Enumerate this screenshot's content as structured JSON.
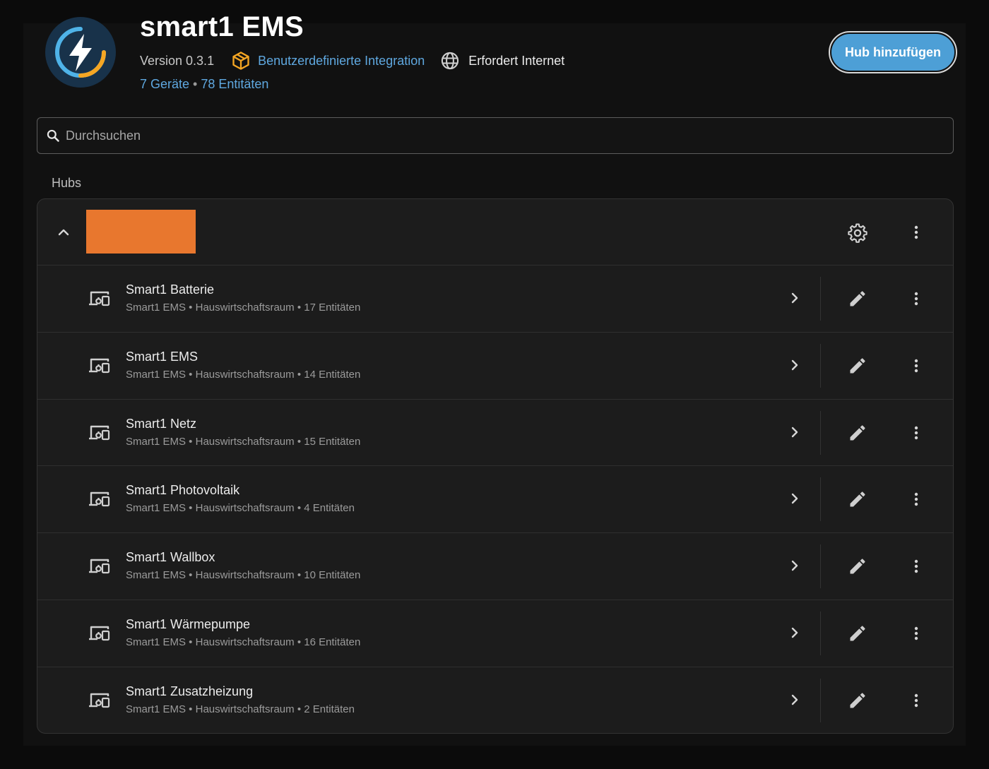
{
  "integration": {
    "title": "smart1 EMS",
    "logo_icon": "lightning-bolt-icon",
    "version": "Version 0.3.1",
    "custom_label": "Benutzerdefinierte Integration",
    "internet_label": "Erfordert Internet",
    "devices_link": "7 Geräte",
    "separator": " • ",
    "entities_link": "78 Entitäten"
  },
  "actions": {
    "add_hub_label": "Hub hinzufügen"
  },
  "search": {
    "placeholder": "Durchsuchen",
    "value": ""
  },
  "section": {
    "hubs_label": "Hubs"
  },
  "hub": {
    "redacted_color": "#e8772e",
    "devices": [
      {
        "name": "Smart1 Batterie",
        "sub": "Smart1 EMS • Hauswirtschaftsraum • 17 Entitäten"
      },
      {
        "name": "Smart1 EMS",
        "sub": "Smart1 EMS • Hauswirtschaftsraum • 14 Entitäten"
      },
      {
        "name": "Smart1 Netz",
        "sub": "Smart1 EMS • Hauswirtschaftsraum • 15 Entitäten"
      },
      {
        "name": "Smart1 Photovoltaik",
        "sub": "Smart1 EMS • Hauswirtschaftsraum • 4 Entitäten"
      },
      {
        "name": "Smart1 Wallbox",
        "sub": "Smart1 EMS • Hauswirtschaftsraum • 10 Entitäten"
      },
      {
        "name": "Smart1 Wärmepumpe",
        "sub": "Smart1 EMS • Hauswirtschaftsraum • 16 Entitäten"
      },
      {
        "name": "Smart1 Zusatzheizung",
        "sub": "Smart1 EMS • Hauswirtschaftsraum • 2 Entitäten"
      }
    ]
  },
  "colors": {
    "accent": "#5fa8e0",
    "button": "#4d9fd6",
    "custom_icon": "#f5a623"
  }
}
